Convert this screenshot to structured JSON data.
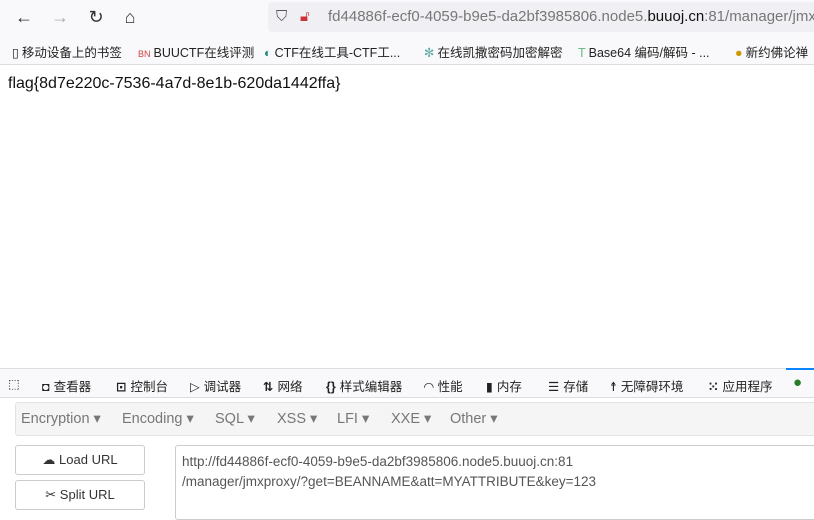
{
  "browser": {
    "url_gray_prefix": "fd44886f-ecf0-4059-b9e5-da2bf3985806.node5.",
    "url_domain": "buuoj.cn",
    "url_suffix": ":81/manager/jmx"
  },
  "bookmarks": [
    "移动设备上的书签",
    "BUUCTF在线评测",
    "CTF在线工具-CTF工...",
    "在线凯撒密码加密解密",
    "Base64 编码/解码 - ...",
    "新约佛论禅"
  ],
  "page": {
    "flag": "flag{8d7e220c-7536-4a7d-8e1b-620da1442ffa}"
  },
  "devtools": {
    "tabs": [
      "查看器",
      "控制台",
      "调试器",
      "网络",
      "样式编辑器",
      "性能",
      "内存",
      "存储",
      "无障碍环境",
      "应用程序"
    ]
  },
  "hackbar": {
    "menus": [
      "Encryption",
      "Encoding",
      "SQL",
      "XSS",
      "LFI",
      "XXE",
      "Other"
    ],
    "load_url": "Load URL",
    "split_url": "Split URL",
    "url_value": "http://fd44886f-ecf0-4059-b9e5-da2bf3985806.node5.buuoj.cn:81\n/manager/jmxproxy/?get=BEANNAME&att=MYATTRIBUTE&key=123"
  }
}
